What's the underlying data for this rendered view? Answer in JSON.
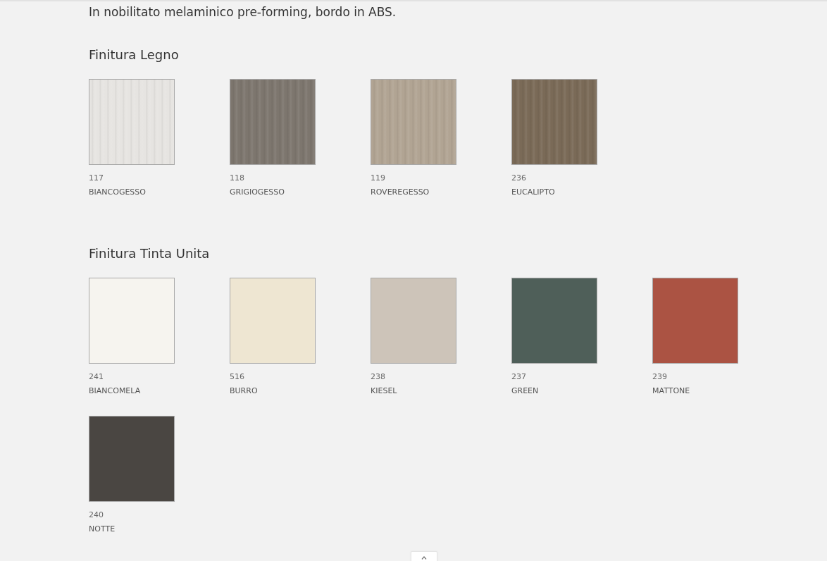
{
  "intro": "In nobilitato melaminico pre-forming, bordo in ABS.",
  "sections": [
    {
      "title": "Finitura Legno",
      "swatches": [
        {
          "code": "117",
          "name": "BIANCOGESSO",
          "kind": "wood",
          "color": "#e6e4e1"
        },
        {
          "code": "118",
          "name": "GRIGIOGESSO",
          "kind": "wood",
          "color": "#7d766e"
        },
        {
          "code": "119",
          "name": "ROVEREGESSO",
          "kind": "wood",
          "color": "#b1a493"
        },
        {
          "code": "236",
          "name": "EUCALIPTO",
          "kind": "wood",
          "color": "#7a6a57"
        }
      ]
    },
    {
      "title": "Finitura Tinta Unita",
      "swatches": [
        {
          "code": "241",
          "name": "BIANCOMELA",
          "kind": "solid",
          "color": "#f6f4ef"
        },
        {
          "code": "516",
          "name": "BURRO",
          "kind": "solid",
          "color": "#eee6d2"
        },
        {
          "code": "238",
          "name": "KIESEL",
          "kind": "solid",
          "color": "#cdc4b9"
        },
        {
          "code": "237",
          "name": "GREEN",
          "kind": "solid",
          "color": "#4f5f59"
        },
        {
          "code": "239",
          "name": "MATTONE",
          "kind": "solid",
          "color": "#ab5343"
        },
        {
          "code": "240",
          "name": "NOTTE",
          "kind": "solid",
          "color": "#4a4642"
        }
      ]
    }
  ]
}
